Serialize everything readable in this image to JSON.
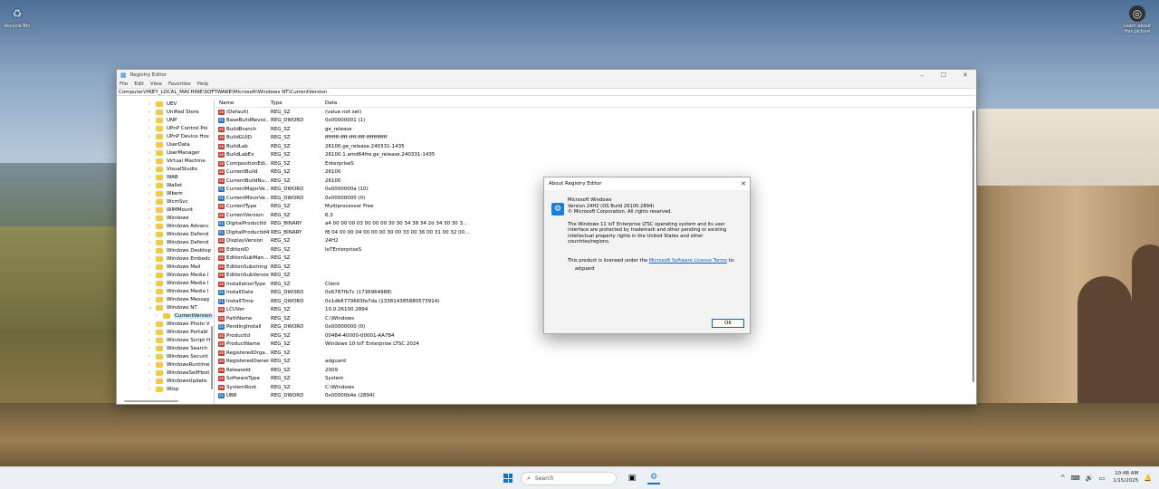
{
  "desktop": {
    "recycle_label": "Recycle Bin",
    "learn_label": "Learn about this picture"
  },
  "window": {
    "title": "Registry Editor",
    "menu": [
      "File",
      "Edit",
      "View",
      "Favorites",
      "Help"
    ],
    "address": "Computer\\HKEY_LOCAL_MACHINE\\SOFTWARE\\Microsoft\\Windows NT\\CurrentVersion"
  },
  "tree": [
    {
      "label": "UEV",
      "arrow": "›"
    },
    {
      "label": "Unified Store",
      "arrow": "›"
    },
    {
      "label": "UNP",
      "arrow": "›"
    },
    {
      "label": "UPnP Control Poi",
      "arrow": "›"
    },
    {
      "label": "UPnP Device Hos",
      "arrow": "›"
    },
    {
      "label": "UserData",
      "arrow": ""
    },
    {
      "label": "UserManager",
      "arrow": "›"
    },
    {
      "label": "Virtual Machine",
      "arrow": "›"
    },
    {
      "label": "VisualStudio",
      "arrow": "›"
    },
    {
      "label": "WAB",
      "arrow": "›"
    },
    {
      "label": "Wallet",
      "arrow": "›"
    },
    {
      "label": "Wbem",
      "arrow": "›"
    },
    {
      "label": "WcmSvc",
      "arrow": "›"
    },
    {
      "label": "WIMMount",
      "arrow": "›"
    },
    {
      "label": "Windows",
      "arrow": "›"
    },
    {
      "label": "Windows Advanc",
      "arrow": "›"
    },
    {
      "label": "Windows Defend",
      "arrow": "›"
    },
    {
      "label": "Windows Defend",
      "arrow": "›"
    },
    {
      "label": "Windows Desktop",
      "arrow": "›"
    },
    {
      "label": "Windows Embedc",
      "arrow": "›"
    },
    {
      "label": "Windows Mail",
      "arrow": "›"
    },
    {
      "label": "Windows Media I",
      "arrow": "›"
    },
    {
      "label": "Windows Media I",
      "arrow": "›"
    },
    {
      "label": "Windows Media I",
      "arrow": "›"
    },
    {
      "label": "Windows Messag",
      "arrow": "›"
    },
    {
      "label": "Windows NT",
      "arrow": "⌄"
    },
    {
      "label": "CurrentVersion",
      "arrow": "›",
      "indent": true,
      "selected": true
    },
    {
      "label": "Windows Photo V",
      "arrow": "›"
    },
    {
      "label": "Windows Portabl",
      "arrow": "›"
    },
    {
      "label": "Windows Script H",
      "arrow": "›"
    },
    {
      "label": "Windows Search",
      "arrow": "›"
    },
    {
      "label": "Windows Securit",
      "arrow": "›"
    },
    {
      "label": "WindowsRuntime",
      "arrow": "›"
    },
    {
      "label": "WindowsSelfHost",
      "arrow": "›"
    },
    {
      "label": "WindowsUpdate",
      "arrow": "›"
    },
    {
      "label": "Wisp",
      "arrow": "›"
    }
  ],
  "columns": {
    "name": "Name",
    "type": "Type",
    "data": "Data"
  },
  "values": [
    {
      "name": "(Default)",
      "type": "REG_SZ",
      "data": "(value not set)",
      "icon": "sz"
    },
    {
      "name": "BaseBuildRevisi...",
      "type": "REG_DWORD",
      "data": "0x00000001 (1)",
      "icon": "bin"
    },
    {
      "name": "BuildBranch",
      "type": "REG_SZ",
      "data": "ge_release",
      "icon": "sz"
    },
    {
      "name": "BuildGUID",
      "type": "REG_SZ",
      "data": "ffffffff-ffff-ffff-ffff-ffffffffffff",
      "icon": "sz"
    },
    {
      "name": "BuildLab",
      "type": "REG_SZ",
      "data": "26100.ge_release.240331-1435",
      "icon": "sz"
    },
    {
      "name": "BuildLabEx",
      "type": "REG_SZ",
      "data": "26100.1.amd64fre.ge_release.240331-1435",
      "icon": "sz"
    },
    {
      "name": "CompositionEdi...",
      "type": "REG_SZ",
      "data": "EnterpriseS",
      "icon": "sz"
    },
    {
      "name": "CurrentBuild",
      "type": "REG_SZ",
      "data": "26100",
      "icon": "sz"
    },
    {
      "name": "CurrentBuildNu...",
      "type": "REG_SZ",
      "data": "26100",
      "icon": "sz"
    },
    {
      "name": "CurrentMajorVe...",
      "type": "REG_DWORD",
      "data": "0x0000000a (10)",
      "icon": "bin"
    },
    {
      "name": "CurrentMinorVe...",
      "type": "REG_DWORD",
      "data": "0x00000000 (0)",
      "icon": "bin"
    },
    {
      "name": "CurrentType",
      "type": "REG_SZ",
      "data": "Multiprocessor Free",
      "icon": "sz"
    },
    {
      "name": "CurrentVersion",
      "type": "REG_SZ",
      "data": "6.3",
      "icon": "sz"
    },
    {
      "name": "DigitalProductId",
      "type": "REG_BINARY",
      "data": "a4 00 00 00 03 00 00 00 30 30 34 38 34 2d 34 30 30 3...",
      "icon": "bin"
    },
    {
      "name": "DigitalProductId4",
      "type": "REG_BINARY",
      "data": "f8 04 00 00 04 00 00 00 30 00 33 00 36 00 31 00 32 00...",
      "icon": "bin"
    },
    {
      "name": "DisplayVersion",
      "type": "REG_SZ",
      "data": "24H2",
      "icon": "sz"
    },
    {
      "name": "EditionID",
      "type": "REG_SZ",
      "data": "IoTEnterpriseS",
      "icon": "sz"
    },
    {
      "name": "EditionSubMan...",
      "type": "REG_SZ",
      "data": "",
      "icon": "sz"
    },
    {
      "name": "EditionSubstring",
      "type": "REG_SZ",
      "data": "",
      "icon": "sz"
    },
    {
      "name": "EditionSubVersion",
      "type": "REG_SZ",
      "data": "",
      "icon": "sz"
    },
    {
      "name": "InstallationType",
      "type": "REG_SZ",
      "data": "Client",
      "icon": "sz"
    },
    {
      "name": "InstallDate",
      "type": "REG_DWORD",
      "data": "0x6787fb7c (1736964988)",
      "icon": "bin"
    },
    {
      "name": "InstallTime",
      "type": "REG_QWORD",
      "data": "0x1db6779683fa7da (133814385880573914)",
      "icon": "bin"
    },
    {
      "name": "LCUVer",
      "type": "REG_SZ",
      "data": "10.0.26100.2894",
      "icon": "sz"
    },
    {
      "name": "PathName",
      "type": "REG_SZ",
      "data": "C:\\Windows",
      "icon": "sz"
    },
    {
      "name": "PendingInstall",
      "type": "REG_DWORD",
      "data": "0x00000000 (0)",
      "icon": "bin"
    },
    {
      "name": "ProductId",
      "type": "REG_SZ",
      "data": "00484-40000-00001-AA784",
      "icon": "sz"
    },
    {
      "name": "ProductName",
      "type": "REG_SZ",
      "data": "Windows 10 IoT Enterprise LTSC 2024",
      "icon": "sz"
    },
    {
      "name": "RegisteredOrga...",
      "type": "REG_SZ",
      "data": "",
      "icon": "sz"
    },
    {
      "name": "RegisteredOwner",
      "type": "REG_SZ",
      "data": "adguard",
      "icon": "sz"
    },
    {
      "name": "ReleaseId",
      "type": "REG_SZ",
      "data": "2009",
      "icon": "sz"
    },
    {
      "name": "SoftwareType",
      "type": "REG_SZ",
      "data": "System",
      "icon": "sz"
    },
    {
      "name": "SystemRoot",
      "type": "REG_SZ",
      "data": "C:\\Windows",
      "icon": "sz"
    },
    {
      "name": "UBR",
      "type": "REG_DWORD",
      "data": "0x00000b4e (2894)",
      "icon": "bin"
    }
  ],
  "dialog": {
    "title": "About Registry Editor",
    "line1": "Microsoft Windows",
    "line2": "Version 24H2 (OS Build 26100.2894)",
    "line3": "© Microsoft Corporation. All rights reserved.",
    "para": "The Windows 11 IoT Enterprise LTSC operating system and its user interface are protected by trademark and other pending or existing intellectual property rights in the United States and other countries/regions.",
    "license_pre": "This product is licensed under the ",
    "license_link": "Microsoft Software License Terms",
    "license_post": " to:",
    "licensee": "adguard",
    "ok": "OK"
  },
  "taskbar": {
    "search_placeholder": "Search",
    "time": "10:48 AM",
    "date": "1/15/2025"
  },
  "colors": {
    "accent": "#0067c0",
    "folder": "#f4c84a",
    "selection": "#cce8ff"
  }
}
